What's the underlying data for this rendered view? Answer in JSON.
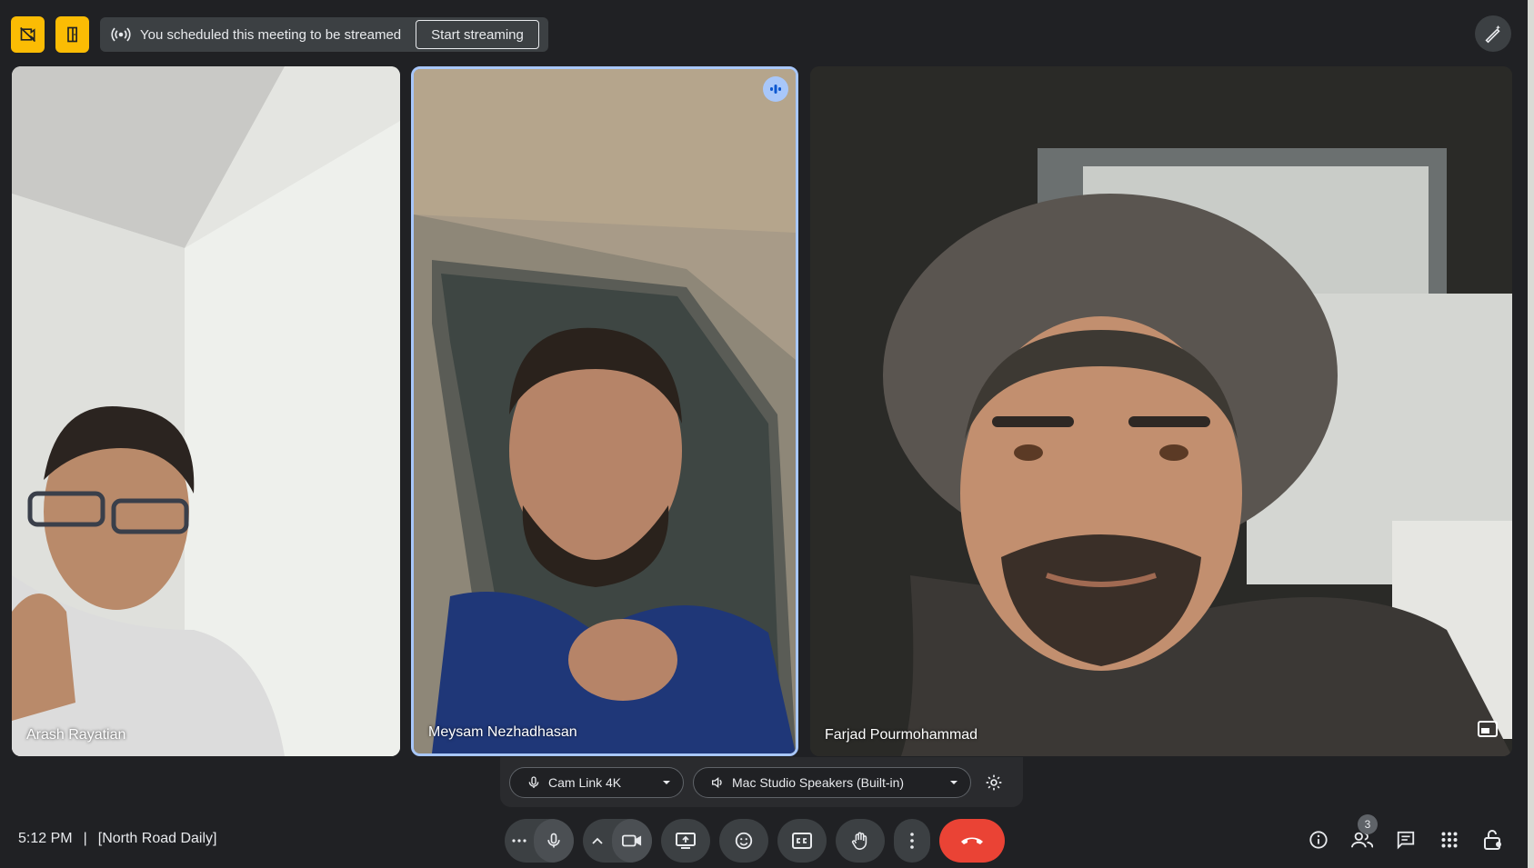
{
  "top_bar": {
    "stream_text": "You scheduled this meeting to be streamed",
    "start_streaming_label": "Start streaming"
  },
  "participants": [
    {
      "name": "Arash Rayatian"
    },
    {
      "name": "Meysam Nezhadhasan"
    },
    {
      "name": "Farjad Pourmohammad"
    }
  ],
  "devices": {
    "microphone": "Cam Link 4K",
    "speaker": "Mac Studio Speakers (Built-in)"
  },
  "meeting": {
    "time": "5:12 PM",
    "separator": "|",
    "title": "[North Road Daily]"
  },
  "people_count": "3",
  "icons": {
    "yellow_1": "video-off-icon",
    "yellow_2": "door-exit-icon",
    "stream": "broadcast-icon",
    "edit": "magic-pen-icon",
    "speaking": "audio-level-icon",
    "pip": "picture-in-picture-icon",
    "mic": "mic-icon",
    "speaker": "volume-icon",
    "settings": "gear-icon",
    "more": "more-horiz-icon",
    "camera": "videocam-icon",
    "present": "present-to-all-icon",
    "emoji": "emoji-icon",
    "captions": "closed-caption-icon",
    "hand": "raise-hand-icon",
    "options": "more-vert-icon",
    "end": "call-end-icon",
    "info": "info-icon",
    "people": "people-icon",
    "chat": "chat-icon",
    "activities": "apps-grid-icon",
    "host": "lock-person-icon"
  },
  "colors": {
    "background": "#202124",
    "yellow": "#fbbc04",
    "speaking_border": "#a8c7fa",
    "end_call": "#ea4335"
  }
}
